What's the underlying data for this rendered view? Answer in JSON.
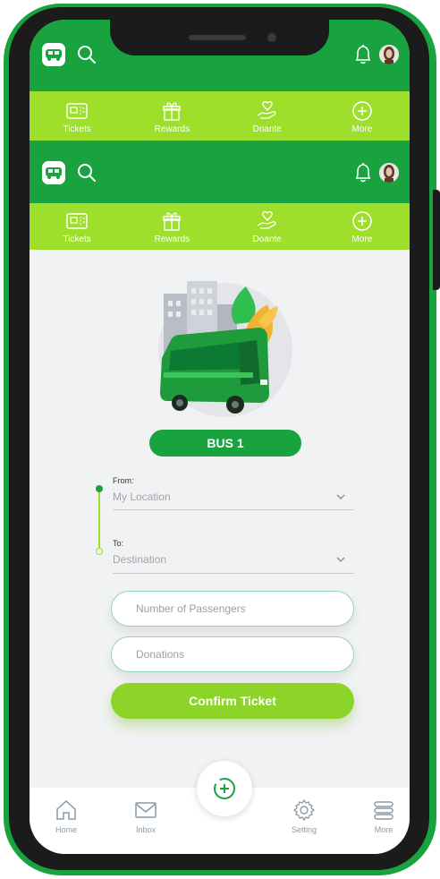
{
  "header": {
    "logo_icon": "bus-logo-icon",
    "search_icon": "search-icon",
    "bell_icon": "bell-icon",
    "avatar_icon": "user-avatar"
  },
  "top_menu": [
    {
      "label": "Tickets",
      "icon": "ticket-icon"
    },
    {
      "label": "Rewards",
      "icon": "gift-icon"
    },
    {
      "label": "Doante",
      "icon": "donate-hand-heart-icon"
    },
    {
      "label": "More",
      "icon": "plus-circle-icon"
    }
  ],
  "bus": {
    "label": "BUS 1"
  },
  "route": {
    "from_label": "From:",
    "from_value": "My Location",
    "to_label": "To:",
    "to_value": "Destination"
  },
  "form": {
    "passengers_placeholder": "Number of Passengers",
    "donations_placeholder": "Donations",
    "confirm_label": "Confirm Ticket"
  },
  "bottom_nav": [
    {
      "label": "Home",
      "icon": "home-icon"
    },
    {
      "label": "Inbox",
      "icon": "mail-icon"
    },
    {
      "label": "Setting",
      "icon": "gear-icon"
    },
    {
      "label": "More",
      "icon": "menu-stack-icon"
    }
  ],
  "colors": {
    "primary": "#19a33f",
    "accent": "#9ddf2a",
    "button": "#8cd428",
    "background": "#f1f2f4"
  }
}
